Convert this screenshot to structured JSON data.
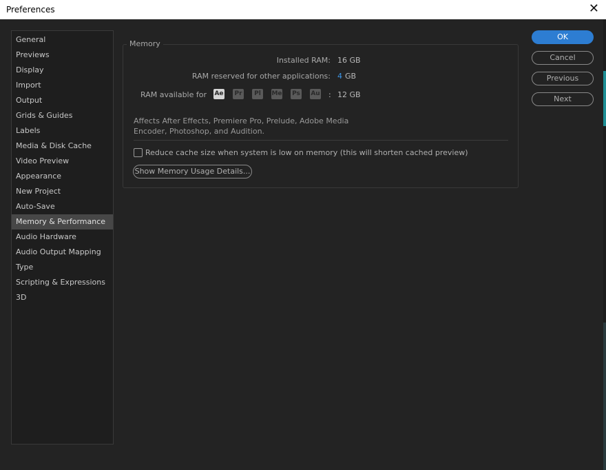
{
  "window": {
    "title": "Preferences",
    "close_glyph": "✕"
  },
  "sidebar": {
    "items": [
      {
        "label": "General"
      },
      {
        "label": "Previews"
      },
      {
        "label": "Display"
      },
      {
        "label": "Import"
      },
      {
        "label": "Output"
      },
      {
        "label": "Grids & Guides"
      },
      {
        "label": "Labels"
      },
      {
        "label": "Media & Disk Cache"
      },
      {
        "label": "Video Preview"
      },
      {
        "label": "Appearance"
      },
      {
        "label": "New Project"
      },
      {
        "label": "Auto-Save"
      },
      {
        "label": "Memory & Performance"
      },
      {
        "label": "Audio Hardware"
      },
      {
        "label": "Audio Output Mapping"
      },
      {
        "label": "Type"
      },
      {
        "label": "Scripting & Expressions"
      },
      {
        "label": "3D"
      }
    ],
    "selected": "Memory & Performance"
  },
  "memory": {
    "group_title": "Memory",
    "installed_label": "Installed RAM:",
    "installed_value": "16 GB",
    "reserved_label": "RAM reserved for other applications:",
    "reserved_value": "4",
    "reserved_unit": "GB",
    "available_label": "RAM available for",
    "apps": [
      "Ae",
      "Pr",
      "Pl",
      "Me",
      "Ps",
      "Au"
    ],
    "available_sep": ":",
    "available_value": "12 GB",
    "description": "Affects After Effects, Premiere Pro, Prelude, Adobe Media Encoder, Photoshop, and Audition.",
    "reduce_cache_label": "Reduce cache size when system is low on memory (this will shorten cached preview)",
    "reduce_cache_checked": false,
    "details_button": "Show Memory Usage Details..."
  },
  "buttons": {
    "ok": "OK",
    "cancel": "Cancel",
    "previous": "Previous",
    "next": "Next"
  },
  "colors": {
    "accent": "#2d7dd2",
    "value_blue": "#3c96e8",
    "selected_item": "#474747"
  }
}
